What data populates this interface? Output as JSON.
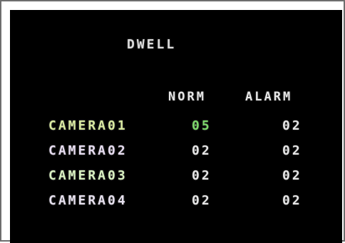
{
  "menu": {
    "title": "DWELL",
    "columns": {
      "norm": "NORM",
      "alarm": "ALARM"
    },
    "rows": [
      {
        "camera": "CAMERA01",
        "norm": "05",
        "alarm": "02"
      },
      {
        "camera": "CAMERA02",
        "norm": "02",
        "alarm": "02"
      },
      {
        "camera": "CAMERA03",
        "norm": "02",
        "alarm": "02"
      },
      {
        "camera": "CAMERA04",
        "norm": "02",
        "alarm": "02"
      }
    ],
    "colors": {
      "background": "#000000",
      "text": "#e6e6e6",
      "selected_value": "#7cd66a"
    }
  }
}
